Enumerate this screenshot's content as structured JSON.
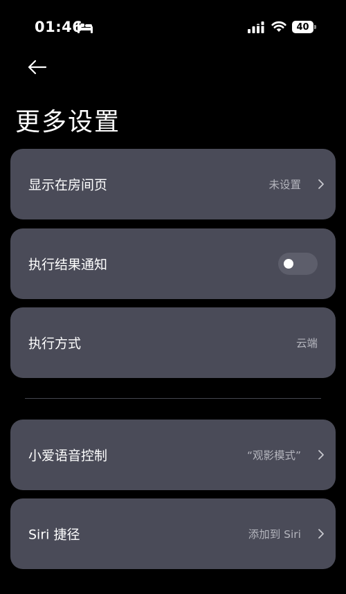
{
  "status_bar": {
    "time": "01:46",
    "sleep_icon": "bed-icon",
    "signal_icon": "cellular-signal-icon",
    "wifi_icon": "wifi-icon",
    "battery_level": "40"
  },
  "header": {
    "back_icon": "arrow-left-icon",
    "title": "更多设置"
  },
  "settings": {
    "display_room": {
      "label": "显示在房间页",
      "value": "未设置",
      "icon": "chevron-right-icon"
    },
    "notify": {
      "label": "执行结果通知",
      "toggle_on": false
    },
    "exec_mode": {
      "label": "执行方式",
      "value": "云端"
    },
    "xiaoai": {
      "label": "小爱语音控制",
      "value": "“观影模式”",
      "icon": "chevron-right-icon"
    },
    "siri": {
      "label": "Siri 捷径",
      "value": "添加到 Siri",
      "icon": "chevron-right-icon"
    }
  },
  "colors": {
    "background": "#000000",
    "card": "#4a4b58",
    "secondary_text": "#b4b5bd",
    "toggle_track": "#5d5e6b"
  }
}
